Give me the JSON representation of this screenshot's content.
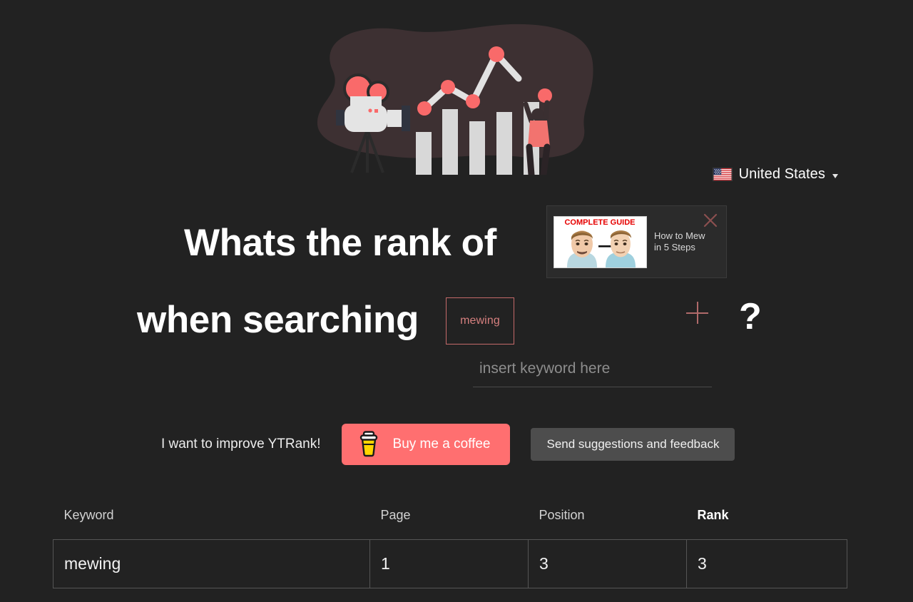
{
  "page": {
    "background_color": "#222222",
    "accent_color": "#ff6f70",
    "chip_border_color": "#c46a6a"
  },
  "illustration": {
    "name": "video-analytics-illustration",
    "blob_color": "#3d3032",
    "bar_color": "#d8d8d8",
    "accent_color": "#f96a6a",
    "camera_label": "film-camera",
    "person_label": "person-raising-bar"
  },
  "country_selector": {
    "flag_icon": "us-flag-icon",
    "name": "United States",
    "caret_icon": "chevron-down-icon"
  },
  "headline": {
    "line1": "Whats the rank of",
    "line2": "when searching",
    "question_mark": "?"
  },
  "video_card": {
    "thumbnail_text": "COMPLETE GUIDE",
    "title": "How to Mew in 5 Steps",
    "close_icon": "close-icon"
  },
  "keyword_chip": {
    "label": "mewing"
  },
  "add_keyword": {
    "icon": "plus-icon"
  },
  "keyword_input": {
    "value": "",
    "placeholder": "insert keyword here"
  },
  "cta": {
    "improve_text": "I want to improve YTRank!",
    "coffee_label": "Buy me a coffee",
    "coffee_icon": "coffee-cup-icon",
    "feedback_label": "Send suggestions and feedback"
  },
  "results": {
    "headers": {
      "keyword": "Keyword",
      "page": "Page",
      "position": "Position",
      "rank": "Rank"
    },
    "rows": [
      {
        "keyword": "mewing",
        "page": "1",
        "position": "3",
        "rank": "3"
      }
    ]
  }
}
